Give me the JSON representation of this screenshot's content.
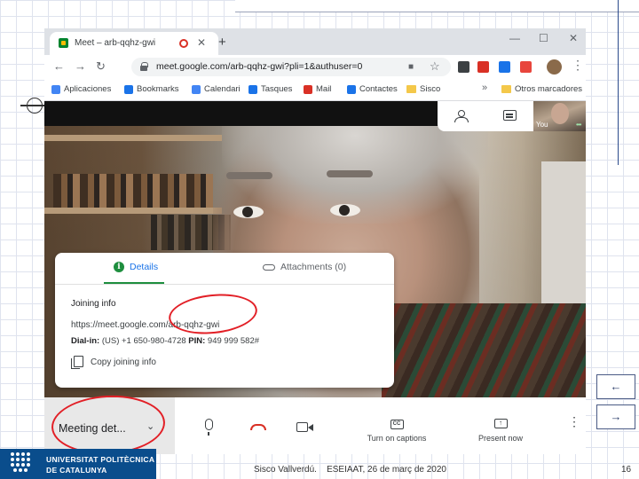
{
  "browser": {
    "tab_title": "Meet – arb-qqhz-gwi",
    "new_tab": "+",
    "tab_close": "✕",
    "window": {
      "minimize": "—",
      "maximize": "☐",
      "close": "✕"
    },
    "nav": {
      "back": "←",
      "forward": "→",
      "reload": "↻"
    },
    "url": "meet.google.com/arb-qqhz-gwi?pli=1&authuser=0",
    "bookmarks": [
      {
        "label": "Aplicaciones",
        "color": "#4285f4"
      },
      {
        "label": "Bookmarks",
        "color": "#1a73e8"
      },
      {
        "label": "Calendari",
        "color": "#4285f4"
      },
      {
        "label": "Tasques",
        "color": "#1a73e8"
      },
      {
        "label": "Mail",
        "color": "#d93025"
      },
      {
        "label": "Contactes",
        "color": "#1a73e8"
      },
      {
        "label": "Sisco"
      }
    ],
    "bookmarks_more": "»",
    "other_bookmarks": "Otros marcadores"
  },
  "meet": {
    "self_label": "You",
    "self_dots": "•••",
    "details_panel": {
      "tab_details": "Details",
      "tab_attachments": "Attachments (0)",
      "joining_info_title": "Joining info",
      "meeting_url": "https://meet.google.com/arb-qqhz-gwi",
      "dial_in_label": "Dial-in:",
      "dial_in_value": "(US) +1 650-980-4728",
      "pin_label": "PIN:",
      "pin_value": "949 999 582#",
      "copy_label": "Copy joining info"
    },
    "bottom_bar": {
      "meeting_details": "Meeting det...",
      "captions_label": "Turn on captions",
      "captions_icon": "CC",
      "present_label": "Present now",
      "present_icon": "↑",
      "more": "⋮",
      "chevron": "⌄"
    }
  },
  "slide": {
    "nav_back": "←",
    "nav_forward": "→",
    "footer_author": "Sisco Vallverdú.",
    "footer_event": "ESEIAAT, 26 de març de 2020",
    "page_number": "16",
    "logo_line1": "UNIVERSITAT POLITÈCNICA",
    "logo_line2": "DE CATALUNYA"
  },
  "colors": {
    "meet_green": "#1e8e3e",
    "annotation_red": "#e21f26",
    "hangup_red": "#d93025",
    "upc_blue": "#0a4d8c"
  }
}
